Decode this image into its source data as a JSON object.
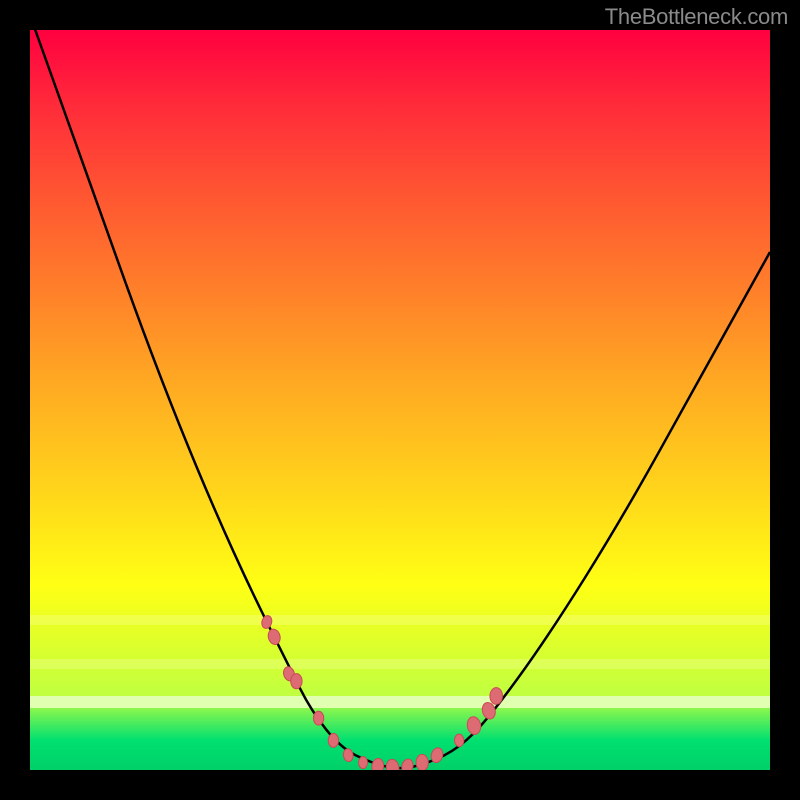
{
  "watermark": "TheBottleneck.com",
  "chart_data": {
    "type": "line",
    "title": "",
    "xlabel": "",
    "ylabel": "",
    "xlim": [
      0,
      100
    ],
    "ylim": [
      0,
      100
    ],
    "grid": false,
    "series": [
      {
        "name": "curve",
        "x": [
          0,
          5,
          10,
          15,
          20,
          25,
          30,
          35,
          38,
          42,
          46,
          50,
          54,
          58,
          62,
          70,
          80,
          90,
          100
        ],
        "y": [
          102,
          88,
          74,
          60,
          47,
          35,
          24,
          14,
          8,
          3,
          1,
          0,
          1,
          3,
          7,
          18,
          34,
          52,
          70
        ]
      }
    ],
    "markers": {
      "name": "cluster",
      "x": [
        32,
        33,
        35,
        36,
        39,
        41,
        43,
        45,
        47,
        49,
        51,
        53,
        55,
        58,
        60,
        62,
        63
      ],
      "y": [
        20,
        18,
        13,
        12,
        7,
        4,
        2,
        1,
        0.5,
        0.3,
        0.5,
        1,
        2,
        4,
        6,
        8,
        10
      ]
    },
    "background_gradient": {
      "top": "#ff0040",
      "mid": "#ffff14",
      "bottom": "#00d068"
    }
  }
}
